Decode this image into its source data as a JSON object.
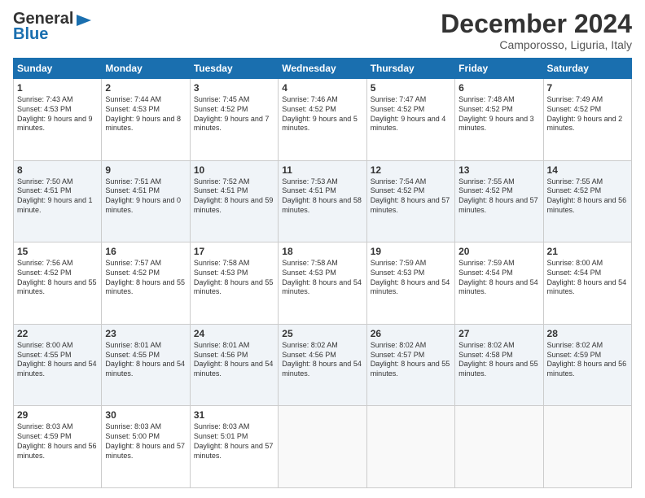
{
  "logo": {
    "line1": "General",
    "line2": "Blue",
    "icon_unicode": "▶"
  },
  "header": {
    "month": "December 2024",
    "location": "Camporosso, Liguria, Italy"
  },
  "weekdays": [
    "Sunday",
    "Monday",
    "Tuesday",
    "Wednesday",
    "Thursday",
    "Friday",
    "Saturday"
  ],
  "weeks": [
    [
      {
        "day": "1",
        "sunrise": "7:43 AM",
        "sunset": "4:53 PM",
        "daylight": "9 hours and 9 minutes."
      },
      {
        "day": "2",
        "sunrise": "7:44 AM",
        "sunset": "4:53 PM",
        "daylight": "9 hours and 8 minutes."
      },
      {
        "day": "3",
        "sunrise": "7:45 AM",
        "sunset": "4:52 PM",
        "daylight": "9 hours and 7 minutes."
      },
      {
        "day": "4",
        "sunrise": "7:46 AM",
        "sunset": "4:52 PM",
        "daylight": "9 hours and 5 minutes."
      },
      {
        "day": "5",
        "sunrise": "7:47 AM",
        "sunset": "4:52 PM",
        "daylight": "9 hours and 4 minutes."
      },
      {
        "day": "6",
        "sunrise": "7:48 AM",
        "sunset": "4:52 PM",
        "daylight": "9 hours and 3 minutes."
      },
      {
        "day": "7",
        "sunrise": "7:49 AM",
        "sunset": "4:52 PM",
        "daylight": "9 hours and 2 minutes."
      }
    ],
    [
      {
        "day": "8",
        "sunrise": "7:50 AM",
        "sunset": "4:51 PM",
        "daylight": "9 hours and 1 minute."
      },
      {
        "day": "9",
        "sunrise": "7:51 AM",
        "sunset": "4:51 PM",
        "daylight": "9 hours and 0 minutes."
      },
      {
        "day": "10",
        "sunrise": "7:52 AM",
        "sunset": "4:51 PM",
        "daylight": "8 hours and 59 minutes."
      },
      {
        "day": "11",
        "sunrise": "7:53 AM",
        "sunset": "4:51 PM",
        "daylight": "8 hours and 58 minutes."
      },
      {
        "day": "12",
        "sunrise": "7:54 AM",
        "sunset": "4:52 PM",
        "daylight": "8 hours and 57 minutes."
      },
      {
        "day": "13",
        "sunrise": "7:55 AM",
        "sunset": "4:52 PM",
        "daylight": "8 hours and 57 minutes."
      },
      {
        "day": "14",
        "sunrise": "7:55 AM",
        "sunset": "4:52 PM",
        "daylight": "8 hours and 56 minutes."
      }
    ],
    [
      {
        "day": "15",
        "sunrise": "7:56 AM",
        "sunset": "4:52 PM",
        "daylight": "8 hours and 55 minutes."
      },
      {
        "day": "16",
        "sunrise": "7:57 AM",
        "sunset": "4:52 PM",
        "daylight": "8 hours and 55 minutes."
      },
      {
        "day": "17",
        "sunrise": "7:58 AM",
        "sunset": "4:53 PM",
        "daylight": "8 hours and 55 minutes."
      },
      {
        "day": "18",
        "sunrise": "7:58 AM",
        "sunset": "4:53 PM",
        "daylight": "8 hours and 54 minutes."
      },
      {
        "day": "19",
        "sunrise": "7:59 AM",
        "sunset": "4:53 PM",
        "daylight": "8 hours and 54 minutes."
      },
      {
        "day": "20",
        "sunrise": "7:59 AM",
        "sunset": "4:54 PM",
        "daylight": "8 hours and 54 minutes."
      },
      {
        "day": "21",
        "sunrise": "8:00 AM",
        "sunset": "4:54 PM",
        "daylight": "8 hours and 54 minutes."
      }
    ],
    [
      {
        "day": "22",
        "sunrise": "8:00 AM",
        "sunset": "4:55 PM",
        "daylight": "8 hours and 54 minutes."
      },
      {
        "day": "23",
        "sunrise": "8:01 AM",
        "sunset": "4:55 PM",
        "daylight": "8 hours and 54 minutes."
      },
      {
        "day": "24",
        "sunrise": "8:01 AM",
        "sunset": "4:56 PM",
        "daylight": "8 hours and 54 minutes."
      },
      {
        "day": "25",
        "sunrise": "8:02 AM",
        "sunset": "4:56 PM",
        "daylight": "8 hours and 54 minutes."
      },
      {
        "day": "26",
        "sunrise": "8:02 AM",
        "sunset": "4:57 PM",
        "daylight": "8 hours and 55 minutes."
      },
      {
        "day": "27",
        "sunrise": "8:02 AM",
        "sunset": "4:58 PM",
        "daylight": "8 hours and 55 minutes."
      },
      {
        "day": "28",
        "sunrise": "8:02 AM",
        "sunset": "4:59 PM",
        "daylight": "8 hours and 56 minutes."
      }
    ],
    [
      {
        "day": "29",
        "sunrise": "8:03 AM",
        "sunset": "4:59 PM",
        "daylight": "8 hours and 56 minutes."
      },
      {
        "day": "30",
        "sunrise": "8:03 AM",
        "sunset": "5:00 PM",
        "daylight": "8 hours and 57 minutes."
      },
      {
        "day": "31",
        "sunrise": "8:03 AM",
        "sunset": "5:01 PM",
        "daylight": "8 hours and 57 minutes."
      },
      null,
      null,
      null,
      null
    ]
  ]
}
